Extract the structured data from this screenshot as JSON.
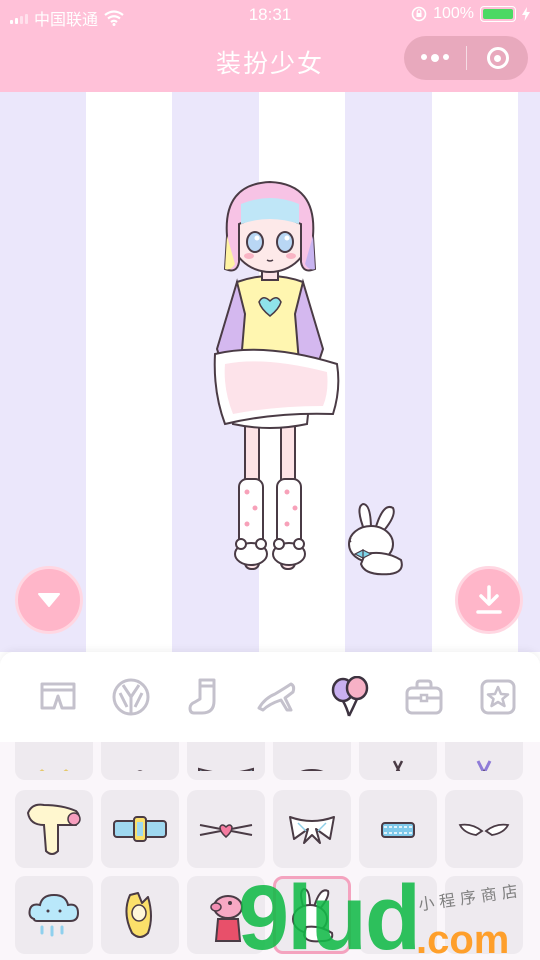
{
  "status_bar": {
    "carrier": "中国联通",
    "time": "18:31",
    "battery_percent": "100%",
    "battery_level": 1.0
  },
  "header": {
    "title": "装扮少女",
    "capsule_more_icon": "more-dots-icon",
    "capsule_close_icon": "target-close-icon"
  },
  "stage": {
    "stripe_colors": [
      "#ebe7fb",
      "#ffffff"
    ],
    "character": "dress-up-girl",
    "pet": "white-bunny",
    "collapse_button_icon": "triangle-down-icon",
    "download_button_icon": "download-icon"
  },
  "categories": [
    {
      "icon": "shorts-icon",
      "active": false
    },
    {
      "icon": "jacket-icon",
      "active": false
    },
    {
      "icon": "sock-icon",
      "active": false
    },
    {
      "icon": "high-heel-icon",
      "active": false
    },
    {
      "icon": "balloons-icon",
      "active": true
    },
    {
      "icon": "bag-icon",
      "active": false
    },
    {
      "icon": "star-icon",
      "active": false
    }
  ],
  "items": [
    {
      "icon": "bows-item-icon"
    },
    {
      "icon": "small-heart-item-icon"
    },
    {
      "icon": "blue-lace-item-icon"
    },
    {
      "icon": "yellow-star-hairpin-icon"
    },
    {
      "icon": "purple-ribbon-icon"
    },
    {
      "icon": "star-medal-icon"
    },
    {
      "icon": "fluffy-scarf-icon"
    },
    {
      "icon": "blue-belt-icon"
    },
    {
      "icon": "heart-choker-icon"
    },
    {
      "icon": "white-bow-collar-icon"
    },
    {
      "icon": "blue-garter-icon"
    },
    {
      "icon": "angel-wings-icon"
    },
    {
      "icon": "rain-cloud-icon"
    },
    {
      "icon": "banana-icon"
    },
    {
      "icon": "pink-pig-icon"
    },
    {
      "icon": "bunny-pet-icon",
      "selected": true
    },
    {
      "icon": "empty-item-icon"
    },
    {
      "icon": "empty-item-icon"
    }
  ],
  "watermark": {
    "brand": "9lud",
    "domain": ".com",
    "caption": "小程序商店"
  },
  "colors": {
    "header_pink": "#ffc1d8",
    "stage_lavender": "#ebe7fb",
    "accent_pink": "#ffb6c9"
  }
}
